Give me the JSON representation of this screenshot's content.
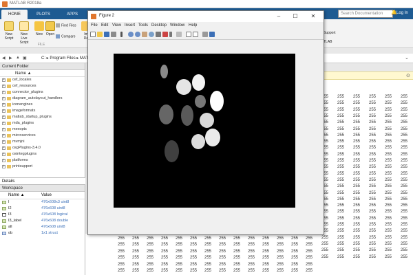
{
  "app": {
    "title": "MATLAB R2018a"
  },
  "tabs": [
    "HOME",
    "PLOTS",
    "APPS"
  ],
  "search": {
    "placeholder": "Search Documentation"
  },
  "login": "Log In",
  "ribbon": {
    "new_script": "New\nScript",
    "new_live_script": "New\nLive Script",
    "new": "New",
    "open": "Open",
    "import": "Im\nDa",
    "find_files": "Find Files",
    "compare": "Compare",
    "file_group": "FILE",
    "support": "Support",
    "tlab": "TLAB"
  },
  "addressbar": {
    "path": "C: ▸ Program Files ▸ MAT"
  },
  "current_folder": {
    "title": "Current Folder",
    "name_header": "Name ▲",
    "items": [
      "cef_locales",
      "cef_resources",
      "connector_plugins",
      "diagram_autolayout_handlers",
      "iconengines",
      "imageformats",
      "matlab_startup_plugins",
      "mda_plugins",
      "mexopts",
      "microservices",
      "mvmjni",
      "osgPlugins-3.4.0",
      "osintegplugins",
      "platforms",
      "printsupport"
    ]
  },
  "details": {
    "label": "Details"
  },
  "workspace": {
    "title": "Workspace",
    "col_name": "Name ▲",
    "col_value": "Value",
    "vars": [
      {
        "name": "I",
        "value": "476x608x3 uint8"
      },
      {
        "name": "I2",
        "value": "476x608 uint8"
      },
      {
        "name": "I3",
        "value": "476x608 logical"
      },
      {
        "name": "I3_label",
        "value": "476x608 double"
      },
      {
        "name": "all",
        "value": "476x608 uint8"
      },
      {
        "name": "ob",
        "value": "1x1 struct"
      }
    ]
  },
  "figure": {
    "title": "Figure 2",
    "menu": [
      "File",
      "Edit",
      "View",
      "Insert",
      "Tools",
      "Desktop",
      "Window",
      "Help"
    ]
  },
  "matrix_value": "255",
  "colors": {
    "ribbon_blue": "#1e5b92",
    "axes_bg": "#000000"
  }
}
